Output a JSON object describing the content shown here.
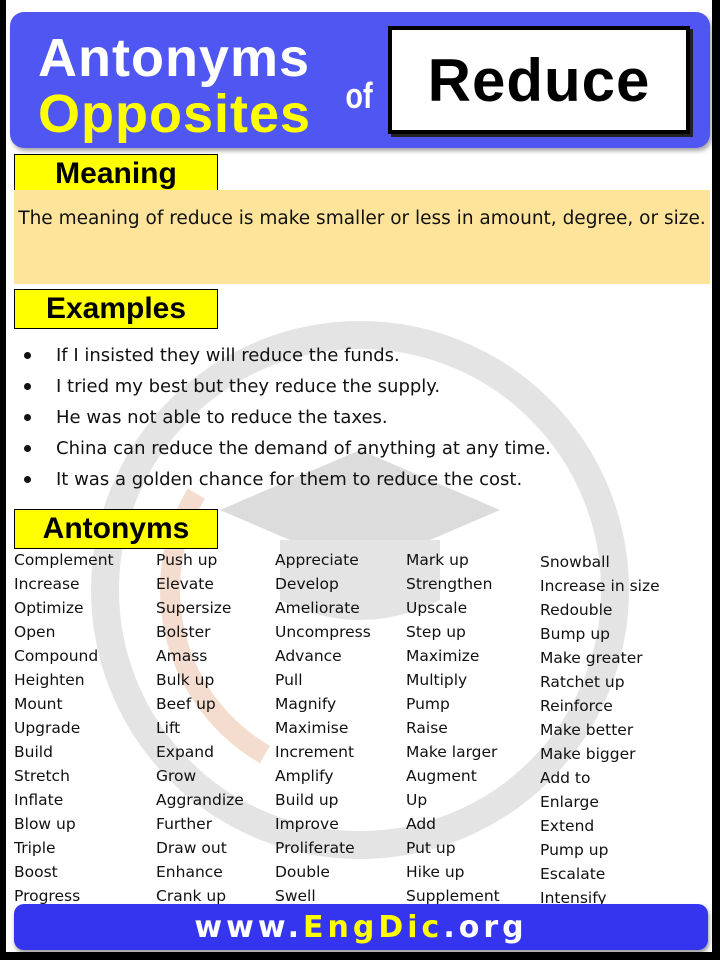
{
  "header": {
    "line1": "Antonyms",
    "line2": "Opposites",
    "connector": "of",
    "word": "Reduce"
  },
  "meaning": {
    "label": "Meaning",
    "text": "The meaning of reduce is make smaller or less in amount, degree, or size."
  },
  "examples": {
    "label": "Examples",
    "items": [
      "If I insisted they will reduce the funds.",
      "I tried my best but they reduce the supply.",
      "He was not able to reduce the taxes.",
      "China can reduce the demand of anything at any time.",
      "It was a golden chance for them to reduce the cost."
    ]
  },
  "antonyms": {
    "label": "Antonyms",
    "columns": [
      [
        "Complement",
        "Increase",
        "Optimize",
        "Open",
        "Compound",
        "Heighten",
        "Mount",
        "Upgrade",
        "Build",
        "Stretch",
        "Inflate",
        "Blow up",
        "Triple",
        "Boost",
        "Progress"
      ],
      [
        "Push up",
        "Elevate",
        "Supersize",
        "Bolster",
        "Amass",
        "Bulk up",
        "Beef up",
        "Lift",
        "Expand",
        "Grow",
        "Aggrandize",
        "Further",
        "Draw out",
        "Enhance",
        "Crank up"
      ],
      [
        "Appreciate",
        "Develop",
        "Ameliorate",
        "Uncompress",
        "Advance",
        "Pull",
        "Magnify",
        "Maximise",
        "Increment",
        "Amplify",
        "Build up",
        "Improve",
        "Proliferate",
        "Double",
        "Swell"
      ],
      [
        "Mark up",
        "Strengthen",
        "Upscale",
        "Step up",
        "Maximize",
        "Multiply",
        "Pump",
        "Raise",
        "Make larger",
        "Augment",
        "Up",
        "Add",
        "Put up",
        "Hike up",
        "Supplement"
      ],
      [
        "Snowball",
        "Increase in size",
        "Redouble",
        "Bump up",
        "Make greater",
        "Ratchet up",
        "Reinforce",
        "Make better",
        "Make bigger",
        "Add to",
        "Enlarge",
        "Extend",
        "Pump up",
        "Escalate",
        "Intensify"
      ]
    ]
  },
  "footer": {
    "part1": "www.",
    "part2": "EngDic",
    "part3": ".org"
  },
  "colors": {
    "header_bg": "#4f56f2",
    "label_bg": "#ffff00",
    "meaning_bg": "#fde49a",
    "footer_bg": "#3535f0"
  }
}
